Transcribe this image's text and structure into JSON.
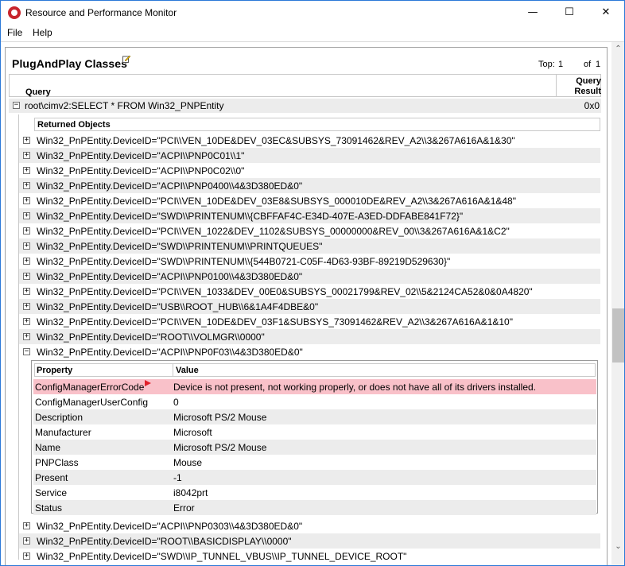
{
  "window": {
    "title": "Resource and Performance Monitor",
    "minimize_glyph": "—",
    "maximize_glyph": "☐",
    "close_glyph": "✕"
  },
  "menu": {
    "file": "File",
    "help": "Help"
  },
  "report": {
    "title": "PlugAndPlay Classes",
    "top_label": "Top:",
    "top_value": "1",
    "of_label": "of",
    "of_value": "1"
  },
  "query_table": {
    "col_query": "Query",
    "col_result_line1": "Query",
    "col_result_line2": "Result",
    "query_text": "root\\cimv2:SELECT * FROM Win32_PNPEntity",
    "query_result": "0x0"
  },
  "returned_objects": {
    "header": "Returned Objects",
    "items": [
      "Win32_PnPEntity.DeviceID=\"PCI\\\\VEN_10DE&DEV_03EC&SUBSYS_73091462&REV_A2\\\\3&267A616A&1&30\"",
      "Win32_PnPEntity.DeviceID=\"ACPI\\\\PNP0C01\\\\1\"",
      "Win32_PnPEntity.DeviceID=\"ACPI\\\\PNP0C02\\\\0\"",
      "Win32_PnPEntity.DeviceID=\"ACPI\\\\PNP0400\\\\4&3D380ED&0\"",
      "Win32_PnPEntity.DeviceID=\"PCI\\\\VEN_10DE&DEV_03E8&SUBSYS_000010DE&REV_A2\\\\3&267A616A&1&48\"",
      "Win32_PnPEntity.DeviceID=\"SWD\\\\PRINTENUM\\\\{CBFFAF4C-E34D-407E-A3ED-DDFABE841F72}\"",
      "Win32_PnPEntity.DeviceID=\"PCI\\\\VEN_1022&DEV_1102&SUBSYS_00000000&REV_00\\\\3&267A616A&1&C2\"",
      "Win32_PnPEntity.DeviceID=\"SWD\\\\PRINTENUM\\\\PRINTQUEUES\"",
      "Win32_PnPEntity.DeviceID=\"SWD\\\\PRINTENUM\\\\{544B0721-C05F-4D63-93BF-89219D529630}\"",
      "Win32_PnPEntity.DeviceID=\"ACPI\\\\PNP0100\\\\4&3D380ED&0\"",
      "Win32_PnPEntity.DeviceID=\"PCI\\\\VEN_1033&DEV_00E0&SUBSYS_00021799&REV_02\\\\5&2124CA52&0&0A4820\"",
      "Win32_PnPEntity.DeviceID=\"USB\\\\ROOT_HUB\\\\6&1A4F4DBE&0\"",
      "Win32_PnPEntity.DeviceID=\"PCI\\\\VEN_10DE&DEV_03F1&SUBSYS_73091462&REV_A2\\\\3&267A616A&1&10\"",
      "Win32_PnPEntity.DeviceID=\"ROOT\\\\VOLMGR\\\\0000\"",
      "Win32_PnPEntity.DeviceID=\"ACPI\\\\PNP0F03\\\\4&3D380ED&0\""
    ],
    "items_after": [
      "Win32_PnPEntity.DeviceID=\"ACPI\\\\PNP0303\\\\4&3D380ED&0\"",
      "Win32_PnPEntity.DeviceID=\"ROOT\\\\BASICDISPLAY\\\\0000\"",
      "Win32_PnPEntity.DeviceID=\"SWD\\\\IP_TUNNEL_VBUS\\\\IP_TUNNEL_DEVICE_ROOT\""
    ]
  },
  "properties": {
    "col_property": "Property",
    "col_value": "Value",
    "rows": [
      {
        "name": "ConfigManagerErrorCode",
        "value": "Device is not present, not working properly, or does not have all of its drivers installed."
      },
      {
        "name": "ConfigManagerUserConfig",
        "value": "0"
      },
      {
        "name": "Description",
        "value": "Microsoft PS/2 Mouse"
      },
      {
        "name": "Manufacturer",
        "value": "Microsoft"
      },
      {
        "name": "Name",
        "value": "Microsoft PS/2 Mouse"
      },
      {
        "name": "PNPClass",
        "value": "Mouse"
      },
      {
        "name": "Present",
        "value": "-1"
      },
      {
        "name": "Service",
        "value": "i8042prt"
      },
      {
        "name": "Status",
        "value": "Error"
      }
    ]
  },
  "scrollbar": {
    "up_glyph": "⌃",
    "down_glyph": "⌄"
  },
  "colors": {
    "error_row": "#f9c1c9",
    "flag": "#e0202a",
    "window_border": "#2b79d8"
  }
}
